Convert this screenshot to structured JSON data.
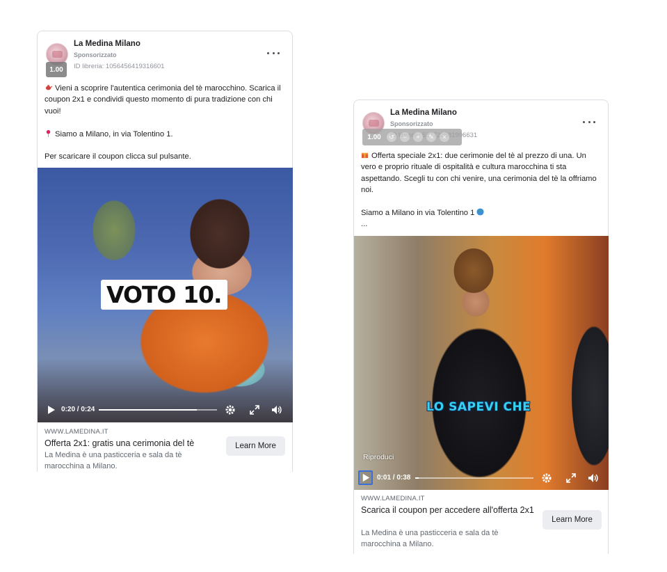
{
  "ads": [
    {
      "page_name": "La Medina Milano",
      "sponsored": "Sponsorizzato",
      "library_id": "ID libreria: 1056456419316601",
      "zoom_value": "1.00",
      "body_lines": [
        "Vieni a scoprire l'autentica cerimonia del tè marocchino. Scarica il coupon 2x1 e condividi questo momento di pura tradizione con chi vuoi!",
        "Siamo a Milano, in via Tolentino 1.",
        "Per scaricare il coupon clicca sul pulsante."
      ],
      "video_overlay": "VOTO 10.",
      "time": "0:20 / 0:24",
      "progress": 0.83,
      "domain": "WWW.LAMEDINA.IT",
      "headline": "Offerta 2x1: gratis una cerimonia del tè",
      "description": "La Medina è una pasticceria e sala da tè marocchina a Milano.",
      "cta": "Learn More",
      "icons": [
        "teapot-emoji",
        "pin-emoji"
      ]
    },
    {
      "page_name": "La Medina Milano",
      "sponsored": "Sponsorizzato",
      "library_id": "ID libreria: 537722581996631",
      "zoom_value": "1.00",
      "body_lines": [
        "Offerta speciale 2x1: due cerimonie del tè al prezzo di una. Un vero e proprio rituale di ospitalità e cultura marocchina ti sta aspettando. Scegli tu con chi venire, una cerimonia del tè la offriamo noi.",
        "Siamo a Milano in via Tolentino 1",
        "..."
      ],
      "video_overlay": "LO SAPEVI CHE",
      "replay_label": "Riproduci",
      "time": "0:01 / 0:38",
      "progress": 0.03,
      "domain": "WWW.LAMEDINA.IT",
      "headline": "Scarica il coupon per accedere all'offerta 2x1",
      "description": "La Medina è una pasticceria e sala da tè marocchina a Milano.",
      "cta": "Learn More",
      "icons": [
        "gift-emoji",
        "globe-emoji"
      ]
    }
  ],
  "colors": {
    "accent_focus": "#3a6fd8",
    "overlay_cyan": "#36d1ee",
    "cta_bg": "#ebedf0"
  }
}
